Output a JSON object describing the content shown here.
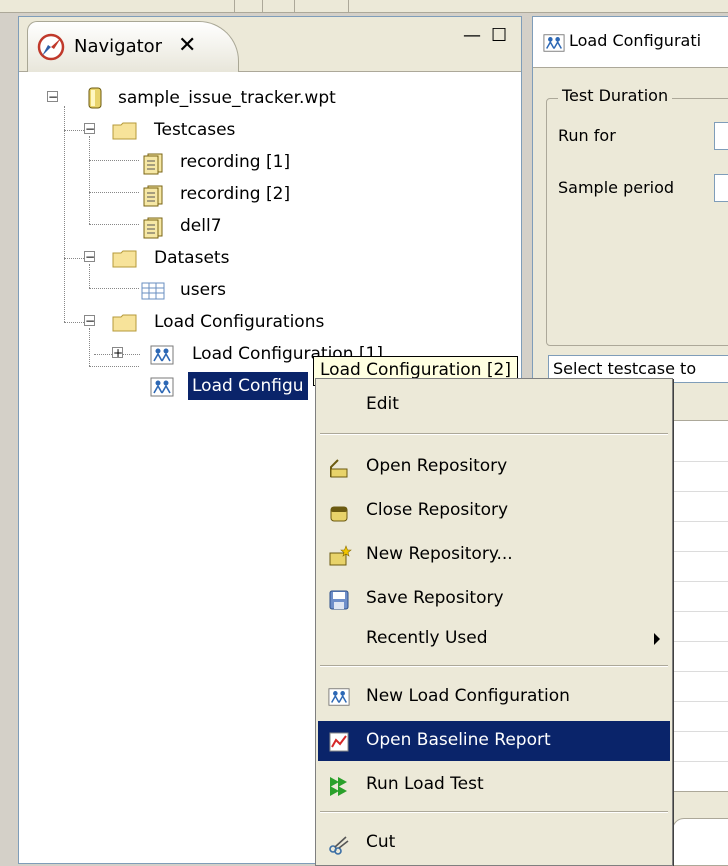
{
  "navigator": {
    "tab_title": "Navigator",
    "tab_close": "✕",
    "minimize": "—",
    "maximize": "☐",
    "tree": {
      "root": "sample_issue_tracker.wpt",
      "testcases_folder": "Testcases",
      "testcases": [
        "recording [1]",
        "recording [2]",
        "dell7"
      ],
      "datasets_folder": "Datasets",
      "datasets": [
        "users"
      ],
      "loadconfigs_folder": "Load Configurations",
      "loadconfigs": [
        "Load Configuration [1]",
        "Load Configuration [2]"
      ]
    },
    "selected_truncated": "Load Configu"
  },
  "tooltip": "Load Configuration [2]",
  "editor": {
    "tab_title": "Load Configurati",
    "group_title": "Test Duration",
    "run_for": "Run for",
    "sample_period": "Sample period",
    "combo": "Select testcase to"
  },
  "context_menu": {
    "items": [
      {
        "label": "Edit",
        "icon": "none"
      },
      {
        "label": "Open Repository",
        "icon": "open-repository-icon"
      },
      {
        "label": "Close Repository",
        "icon": "close-repository-icon"
      },
      {
        "label": "New Repository...",
        "icon": "new-repository-icon"
      },
      {
        "label": "Save Repository",
        "icon": "save-icon"
      },
      {
        "label": "Recently Used",
        "icon": "none"
      },
      {
        "label": "New Load Configuration",
        "icon": "load-configuration-icon"
      },
      {
        "label": "Open Baseline Report",
        "icon": "report-icon"
      },
      {
        "label": "Run Load Test",
        "icon": "run-icon"
      },
      {
        "label": "Cut",
        "icon": "scissors-icon"
      }
    ],
    "highlighted_index": 7
  },
  "colors": {
    "selection": "#0a246a",
    "tooltip_bg": "#ffffe1",
    "menu_bg": "#ece9d8"
  }
}
